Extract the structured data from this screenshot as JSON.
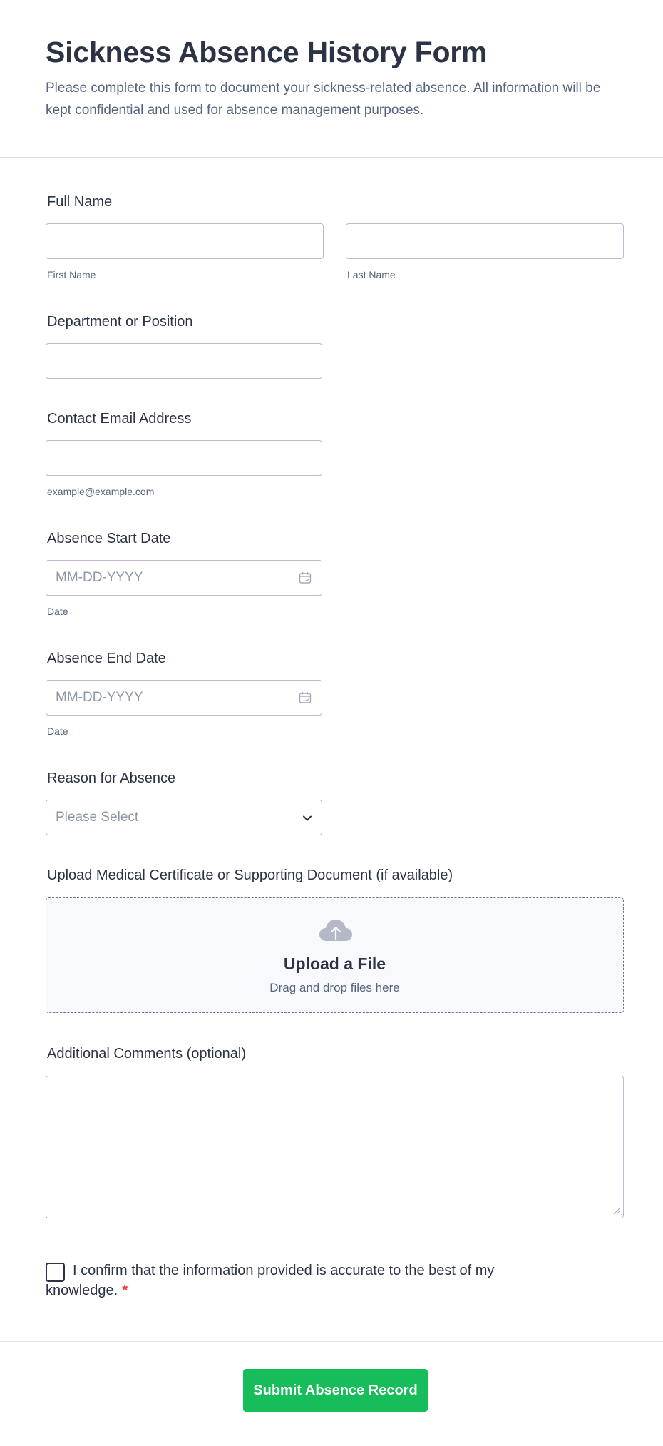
{
  "header": {
    "title": "Sickness Absence History Form",
    "subtitle": "Please complete this form to document your sickness-related absence. All information will be kept confidential and used for absence management purposes."
  },
  "full_name": {
    "label": "Full Name",
    "first_sublabel": "First Name",
    "last_sublabel": "Last Name",
    "first_value": "",
    "last_value": ""
  },
  "department": {
    "label": "Department or Position",
    "value": ""
  },
  "email": {
    "label": "Contact Email Address",
    "sublabel": "example@example.com",
    "value": ""
  },
  "start_date": {
    "label": "Absence Start Date",
    "placeholder": "MM-DD-YYYY",
    "sublabel": "Date"
  },
  "end_date": {
    "label": "Absence End Date",
    "placeholder": "MM-DD-YYYY",
    "sublabel": "Date"
  },
  "reason": {
    "label": "Reason for Absence",
    "selected": "Please Select"
  },
  "upload": {
    "label": "Upload Medical Certificate or Supporting Document (if available)",
    "title": "Upload a File",
    "subtitle": "Drag and drop files here"
  },
  "comments": {
    "label": "Additional Comments (optional)",
    "value": ""
  },
  "consent": {
    "text": "I confirm that the information provided is accurate to the best of my knowledge.",
    "required_mark": "*",
    "checked": false
  },
  "submit": {
    "label": "Submit Absence Record"
  },
  "colors": {
    "accent": "#18bd5b",
    "text": "#2c3345",
    "muted": "#57647e",
    "border": "#b8bdc9",
    "required": "#f23a3c"
  },
  "icons": [
    "calendar-icon",
    "chevron-down-icon",
    "cloud-upload-icon",
    "resize-handle-icon"
  ]
}
